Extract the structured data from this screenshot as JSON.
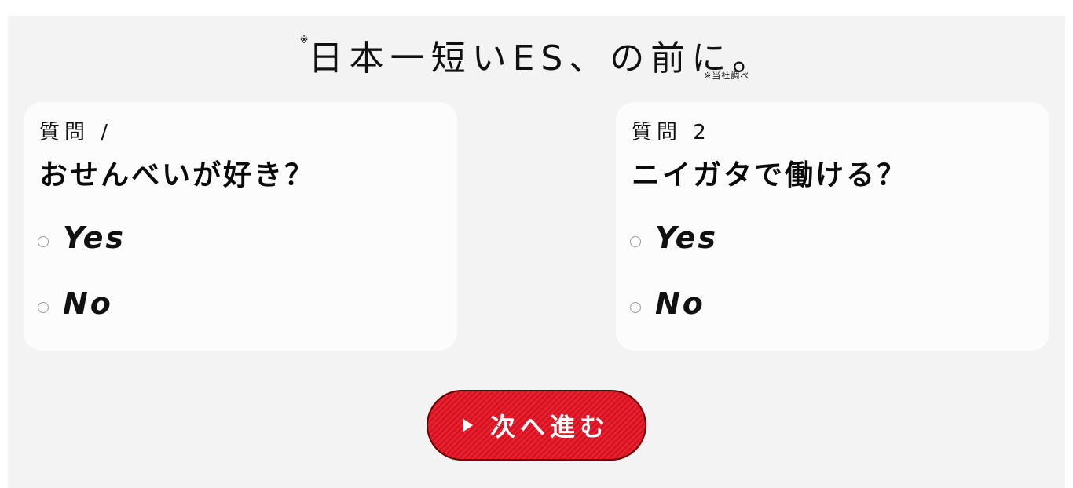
{
  "header": {
    "title_mark": "※",
    "title": "日本一短いES、の前に。",
    "note": "※当社調べ"
  },
  "questions": [
    {
      "number_label": "質問 /",
      "text": "おせんべいが好き？",
      "options": [
        {
          "label": "Yes",
          "selected": false
        },
        {
          "label": "No",
          "selected": false
        }
      ]
    },
    {
      "number_label": "質問 2",
      "text": "ニイガタで働ける？",
      "options": [
        {
          "label": "Yes",
          "selected": false
        },
        {
          "label": "No",
          "selected": false
        }
      ]
    }
  ],
  "next_button": {
    "label": "次へ進む",
    "icon": "play-arrow-icon",
    "color": "#dd1020"
  }
}
